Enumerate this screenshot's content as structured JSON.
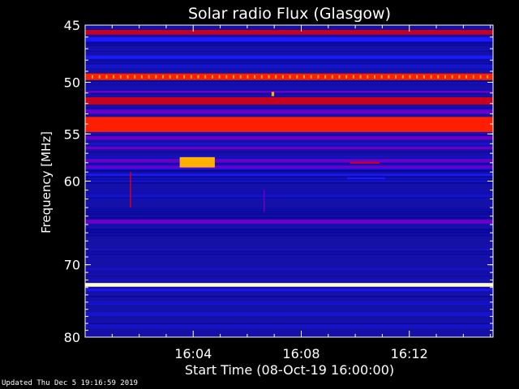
{
  "chart_data": {
    "type": "heatmap",
    "title": "Solar radio Flux (Glasgow)",
    "xlabel": "Start Time (08-Oct-19 16:00:00)",
    "ylabel": "Frequency [MHz]",
    "x_unit": "minutes after 16:00",
    "xlim": [
      0,
      15.1
    ],
    "ylim": [
      45,
      80
    ],
    "y_inverted": true,
    "y_scale": "log",
    "x_ticks": [
      {
        "value": 4,
        "label": "16:04"
      },
      {
        "value": 8,
        "label": "16:08"
      },
      {
        "value": 12,
        "label": "16:12"
      }
    ],
    "y_ticks": [
      {
        "value": 45,
        "label": "45"
      },
      {
        "value": 50,
        "label": "50"
      },
      {
        "value": 55,
        "label": "55"
      },
      {
        "value": 60,
        "label": "60"
      },
      {
        "value": 70,
        "label": "70"
      },
      {
        "value": 80,
        "label": "80"
      }
    ],
    "colormap": [
      "#00008b",
      "#1a1aff",
      "#6a00c8",
      "#c8001e",
      "#ff1e00",
      "#ffb000",
      "#ffffc8"
    ],
    "background_color": "#1410a8",
    "bands": [
      {
        "freq_min": 45.4,
        "freq_max": 45.8,
        "level": 3
      },
      {
        "freq_min": 46.0,
        "freq_max": 46.4,
        "level": 1
      },
      {
        "freq_min": 47.6,
        "freq_max": 47.9,
        "level": 1
      },
      {
        "freq_min": 49.2,
        "freq_max": 49.8,
        "level": 4,
        "dotted": true
      },
      {
        "freq_min": 50.8,
        "freq_max": 51.0,
        "level": 2
      },
      {
        "freq_min": 51.4,
        "freq_max": 52.1,
        "level": 3
      },
      {
        "freq_min": 52.6,
        "freq_max": 53.0,
        "level": 2
      },
      {
        "freq_min": 53.3,
        "freq_max": 54.8,
        "level": 4
      },
      {
        "freq_min": 55.2,
        "freq_max": 55.6,
        "level": 2
      },
      {
        "freq_min": 56.3,
        "freq_max": 56.6,
        "level": 2
      },
      {
        "freq_min": 57.6,
        "freq_max": 58.0,
        "level": 2
      },
      {
        "freq_min": 58.3,
        "freq_max": 58.6,
        "level": 2
      },
      {
        "freq_min": 59.2,
        "freq_max": 59.4,
        "level": 1
      },
      {
        "freq_min": 64.4,
        "freq_max": 64.9,
        "level": 2
      },
      {
        "freq_min": 72.4,
        "freq_max": 72.9,
        "level": 6
      },
      {
        "freq_min": 73.2,
        "freq_max": 73.4,
        "level": 1
      }
    ],
    "events": [
      {
        "t_start": 3.5,
        "t_end": 4.8,
        "freq_min": 57.4,
        "freq_max": 58.5,
        "level": 5
      },
      {
        "t_start": 9.8,
        "t_end": 10.9,
        "freq_min": 57.9,
        "freq_max": 58.1,
        "level": 3
      },
      {
        "t_start": 9.7,
        "t_end": 11.1,
        "freq_min": 59.6,
        "freq_max": 59.8,
        "level": 1
      },
      {
        "t_start": 6.9,
        "t_end": 7.0,
        "freq_min": 50.9,
        "freq_max": 51.3,
        "level": 5
      },
      {
        "t_start": 1.65,
        "t_end": 1.7,
        "freq_min": 59.0,
        "freq_max": 63.0,
        "level": 3
      },
      {
        "t_start": 6.6,
        "t_end": 6.65,
        "freq_min": 61.0,
        "freq_max": 63.5,
        "level": 2
      }
    ],
    "colors": {
      "axes": "#ffffff",
      "text": "#ffffff",
      "figure_background": "#000000"
    }
  },
  "footer": {
    "updated": "Updated Thu Dec  5 19:16:59 2019"
  }
}
